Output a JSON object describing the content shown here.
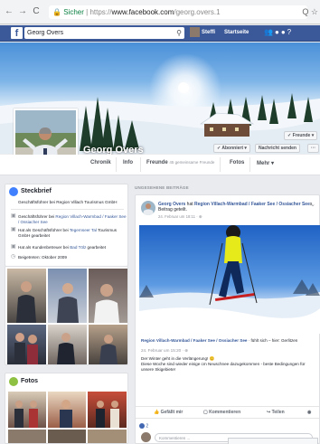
{
  "browser": {
    "back": "←",
    "forward": "→",
    "reload": "C",
    "secure_label": "Sicher",
    "url_scheme": "https://",
    "url_host": "www.facebook.com",
    "url_path": "/georg.overs.1",
    "actions": "Q ☆"
  },
  "fbbar": {
    "search_value": "Georg Overs",
    "user_label": "Steffi",
    "home_label": "Startseite"
  },
  "profile": {
    "name": "Georg Overs",
    "buttons": {
      "friends": "✓ Freunde ▾",
      "subscribed": "✓ Abonniert ▾",
      "message": "Nachricht senden",
      "more": "···"
    }
  },
  "tabs": [
    {
      "label": "Chronik"
    },
    {
      "label": "Info"
    },
    {
      "label": "Freunde",
      "sub": "45 gemeinsame Freunde"
    },
    {
      "label": "Fotos"
    },
    {
      "label": "Mehr ▾"
    }
  ],
  "intro": {
    "title": "Steckbrief",
    "summary": "Geschäftsführer bei Region Villach Tourismus GmbH",
    "rows": [
      {
        "pre": "Geschäftsführer bei ",
        "link": "Region Villach-Warmbad / Faaker See / Ossiacher See",
        "post": ""
      },
      {
        "pre": "Hat als Geschäftsführer bei ",
        "link": "Tegernseer Tal",
        "post": " Tourismus GmbH gearbeitet"
      },
      {
        "pre": "Hat als Kundenbetreuer bei ",
        "link": "Bad Tölz",
        "post": " gearbeitet"
      },
      {
        "pre": "Beigetreten: Oktober 2009",
        "link": "",
        "post": ""
      }
    ]
  },
  "photos_card": {
    "title": "Fotos"
  },
  "feed": {
    "section_label": "UNGESEHENE BEITRÄGE",
    "post": {
      "author": "Georg Overs",
      "action_pre": " hat ",
      "page": "Region Villach-Warmbad / Faaker See / Ossiacher See",
      "action_post": "s Beitrag geteilt.",
      "time": "24. Februar um 18:11 · ⊕",
      "shared_page": "Region Villach-Warmbad / Faaker See / Ossiacher See",
      "shared_extra": " · fühlt sich – hier: Gerlitzen",
      "shared_time": "24. Februar um 15:20 · ⊕",
      "shared_text": "Der Winter geht in die Verlängerung! 😊",
      "shared_text2": "Diese Woche sind wieder einige cm Neuschnee dazugekommen - beste Bedingungen für unsere Skigebiete!",
      "like_label": "Gefällt mir",
      "comment_label": "Kommentieren",
      "share_label": "Teilen",
      "likes_count": "2",
      "comment_placeholder": "Kommentieren ..."
    }
  }
}
